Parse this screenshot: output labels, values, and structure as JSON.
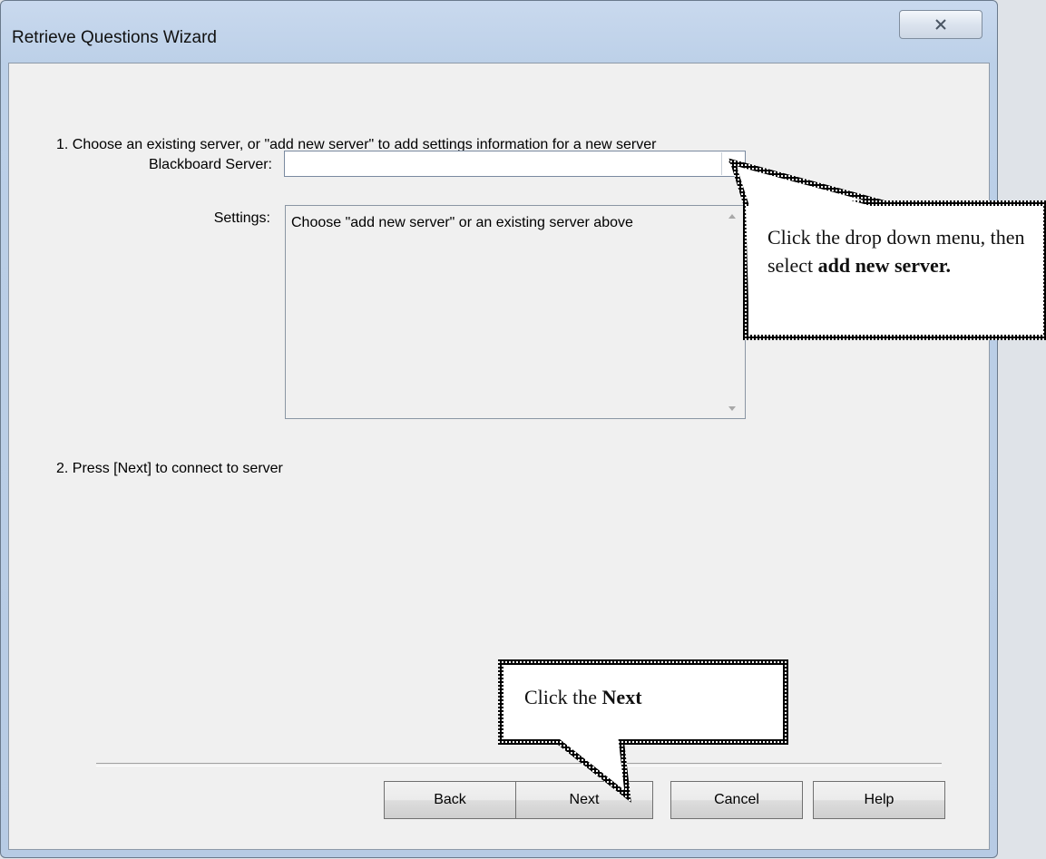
{
  "window": {
    "title": "Retrieve Questions Wizard",
    "close_icon": "close-icon"
  },
  "step1": {
    "instruction": "1. Choose an existing server, or \"add new server\" to add settings information for a new server",
    "server_label": "Blackboard Server:",
    "server_value": "",
    "settings_label": "Settings:",
    "settings_text": "Choose \"add new server\" or an existing server above"
  },
  "step2": {
    "instruction": "2. Press [Next] to connect to server"
  },
  "buttons": {
    "back": "Back",
    "next": "Next",
    "cancel": "Cancel",
    "help": "Help"
  },
  "callouts": {
    "dropdown": {
      "text_plain": "Click the drop down menu, then select ",
      "text_bold": "add new server."
    },
    "next": {
      "text_plain": "Click the ",
      "text_bold": "Next"
    }
  },
  "colors": {
    "dialog_bg": "#f0f0f0",
    "titlebar": "#bcd0e8",
    "callout_border": "#000000"
  }
}
